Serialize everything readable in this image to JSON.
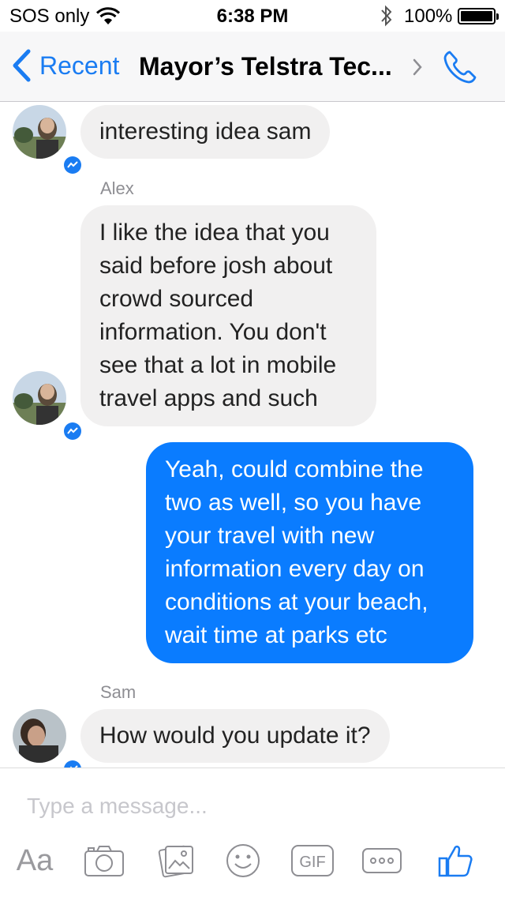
{
  "status_bar": {
    "carrier": "SOS only",
    "time": "6:38 PM",
    "battery": "100%"
  },
  "nav": {
    "back_label": "Recent",
    "title": "Mayor’s Telstra Tec..."
  },
  "messages": [
    {
      "text_lines": [
        "interesting idea sam"
      ]
    },
    {
      "sender": "Alex",
      "text_lines": [
        "I like the idea that you",
        "said before josh about",
        "crowd sourced",
        "information. You don't",
        "see that a lot in mobile",
        "travel apps and such"
      ]
    },
    {
      "text_lines": [
        "Yeah, could combine the",
        "two as well, so you have",
        "your travel with new",
        "information every day on",
        "conditions at your beach,",
        "wait time at parks etc"
      ]
    },
    {
      "sender": "Sam",
      "text_lines": [
        "How would you update it?"
      ]
    }
  ],
  "composer": {
    "placeholder": "Type a message...",
    "tools": {
      "aa_label": "Aa",
      "gif_label": "GIF"
    }
  },
  "colors": {
    "accent": "#1a7cf2",
    "outgoing_bubble": "#0a7cff",
    "incoming_bubble": "#f1f0f0"
  }
}
